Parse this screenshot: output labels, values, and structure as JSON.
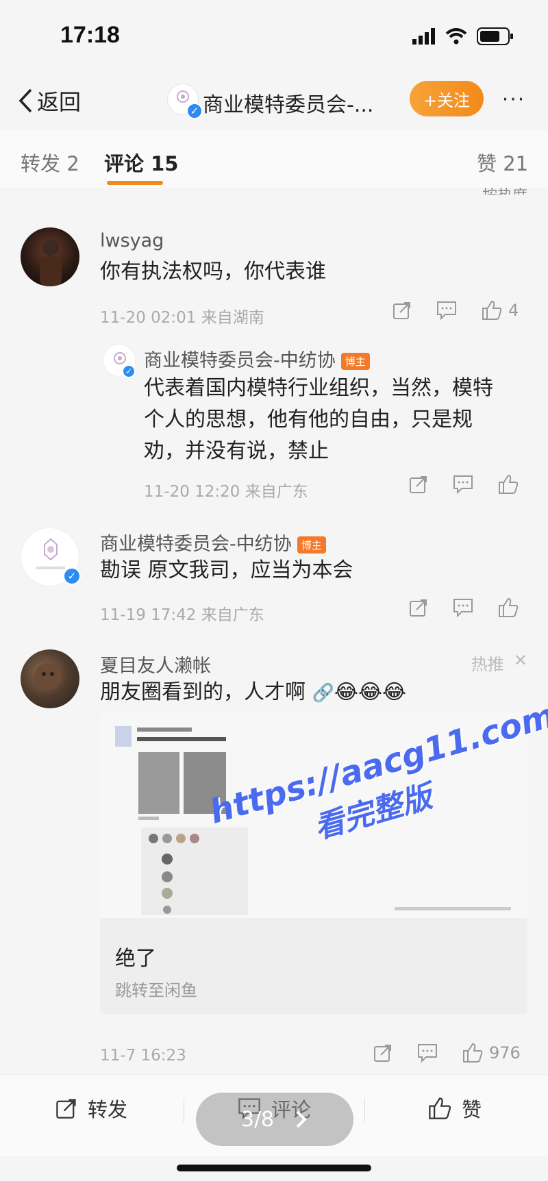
{
  "status": {
    "time": "17:18"
  },
  "nav": {
    "back_label": "返回",
    "title": "商业模特委员会-...",
    "follow_label": "+关注",
    "more": "···"
  },
  "tabs": {
    "repost": "转发 2",
    "comments": "评论 15",
    "likes": "赞 21",
    "sort": "按热度"
  },
  "comments": [
    {
      "username": "lwsyag",
      "text": "你有执法权吗，你代表谁",
      "meta": "11-20 02:01  来自湖南",
      "like_count": "4",
      "reply": {
        "username": "商业模特委员会-中纺协",
        "badge": "博主",
        "text_lines": [
          "代表着国内模特行业组织，当然，模特",
          "个人的思想，他有他的自由，只是规",
          "劝，并没有说，禁止"
        ],
        "meta": "11-20 12:20  来自广东"
      }
    },
    {
      "username": "商业模特委员会-中纺协",
      "badge": "博主",
      "text": "勘误 原文我司，应当为本会",
      "meta": "11-19 17:42  来自广东"
    },
    {
      "username": "夏目友人濑帐",
      "hot_label": "热推",
      "text": "朋友圈看到的，人才啊",
      "emojis": "😂😂😂",
      "card_title": "绝了",
      "card_sub": "跳转至闲鱼",
      "meta": "11-7 16:23",
      "like_count": "976"
    }
  ],
  "watermark": {
    "line1": "https://aacg11.com",
    "line2": "看完整版"
  },
  "bottom": {
    "repost": "转发",
    "comment": "评论",
    "like": "赞",
    "pager": "3/8"
  },
  "colors": {
    "accent": "#f28a1a",
    "verified": "#2e8cf0",
    "watermark": "#4a6bf0"
  }
}
